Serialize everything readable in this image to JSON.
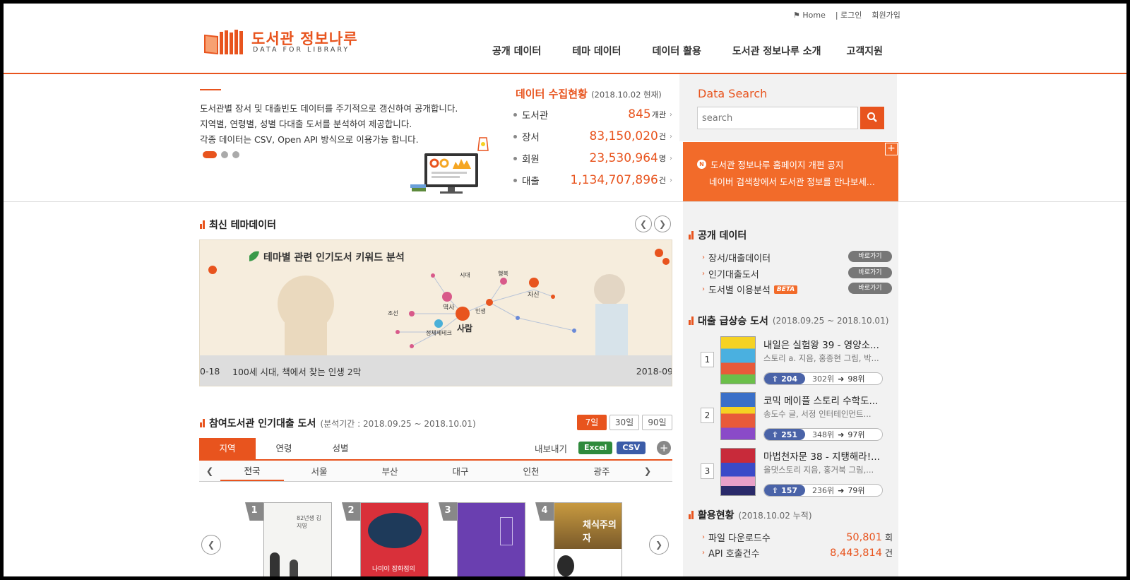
{
  "util": {
    "home": "Home",
    "login": "로그인",
    "join": "회원가입"
  },
  "logo": {
    "ko": "도서관 정보나루",
    "en": "DATA FOR LIBRARY"
  },
  "gnb": [
    "공개 데이터",
    "테마 데이터",
    "데이터 활용",
    "도서관 정보나루 소개",
    "고객지원"
  ],
  "intro": {
    "lines": [
      "도서관별 장서 및 대출빈도 데이터를 주기적으로 갱신하여 공개합니다.",
      "지역별, 연령별, 성별 다대출 도서를 분석하여 제공합니다.",
      "각종 데이터는 CSV, Open API 방식으로 이용가능 합니다."
    ]
  },
  "stats": {
    "title": "데이터 수집현황",
    "asof": "(2018.10.02 현재)",
    "rows": [
      {
        "label": "도서관",
        "value": "845",
        "unit": "개관"
      },
      {
        "label": "장서",
        "value": "83,150,020",
        "unit": "건"
      },
      {
        "label": "회원",
        "value": "23,530,964",
        "unit": "명"
      },
      {
        "label": "대출",
        "value": "1,134,707,896",
        "unit": "건"
      }
    ]
  },
  "search": {
    "title": "Data Search",
    "placeholder": "search"
  },
  "notice": {
    "line1": "도서관 정보나루 홈페이지 개편 공지",
    "line2": "네이버 검색창에서 도서관 정보를 만나보세...",
    "badge": "N"
  },
  "theme": {
    "title": "최신 테마데이터",
    "banner_heading": "테마별 관련 인기도서 키워드 분석",
    "caption_left": "0-18",
    "caption_text": "100세 시대, 책에서 찾는 인생 2막",
    "caption_right": "2018-09",
    "keywords": [
      "사람",
      "역사",
      "인생",
      "자신",
      "조선",
      "정체제테크",
      "행복",
      "시대"
    ]
  },
  "open_data": {
    "title": "공개 데이터",
    "items": [
      {
        "label": "장서/대출데이터",
        "btn": "바로가기"
      },
      {
        "label": "인기대출도서",
        "btn": "바로가기"
      },
      {
        "label": "도서별 이용분석",
        "btn": "바로가기",
        "badge": "BETA"
      }
    ]
  },
  "rising": {
    "title": "대출 급상승 도서",
    "period": "(2018.09.25 ~ 2018.10.01)",
    "items": [
      {
        "rank": "1",
        "title": "내일은 실험왕 39 - 영양소...",
        "author": "스토리 a. 지음, 홍종현 그림, 박...",
        "up": "204",
        "from": "302위",
        "to": "98위"
      },
      {
        "rank": "2",
        "title": "코믹 메이플 스토리 수학도...",
        "author": "송도수 글, 서정 인터테인먼트...",
        "up": "251",
        "from": "348위",
        "to": "97위"
      },
      {
        "rank": "3",
        "title": "마법천자문 38 - 지탱해라!...",
        "author": "올댓스토리 지음, 홍거북 그림,...",
        "up": "157",
        "from": "236위",
        "to": "79위"
      }
    ]
  },
  "usage": {
    "title": "활용현황",
    "asof": "(2018.10.02 누적)",
    "rows": [
      {
        "label": "파일 다운로드수",
        "value": "50,801",
        "unit": "회"
      },
      {
        "label": "API 호출건수",
        "value": "8,443,814",
        "unit": "건"
      }
    ]
  },
  "popular": {
    "title": "참여도서관 인기대출 도서",
    "period": "(분석기간 : 2018.09.25 ~ 2018.10.01)",
    "periods": [
      "7일",
      "30일",
      "90일"
    ],
    "tabs": [
      "지역",
      "연령",
      "성별"
    ],
    "export_label": "내보내기",
    "excel": "Excel",
    "csv": "CSV",
    "regions": [
      "전국",
      "서울",
      "부산",
      "대구",
      "인천",
      "광주"
    ],
    "books": [
      {
        "rank": "1",
        "cover_text": "82년생 김지영"
      },
      {
        "rank": "2",
        "cover_text": "나미야 잡화점의"
      },
      {
        "rank": "3",
        "cover_text": ""
      },
      {
        "rank": "4",
        "cover_text": "채식주의자"
      }
    ]
  },
  "colors": {
    "accent": "#e8541e",
    "notice_bg": "#f26b2a",
    "rank_up": "#4a63a8",
    "excel": "#2f8a3c",
    "csv": "#3b5ca8"
  }
}
